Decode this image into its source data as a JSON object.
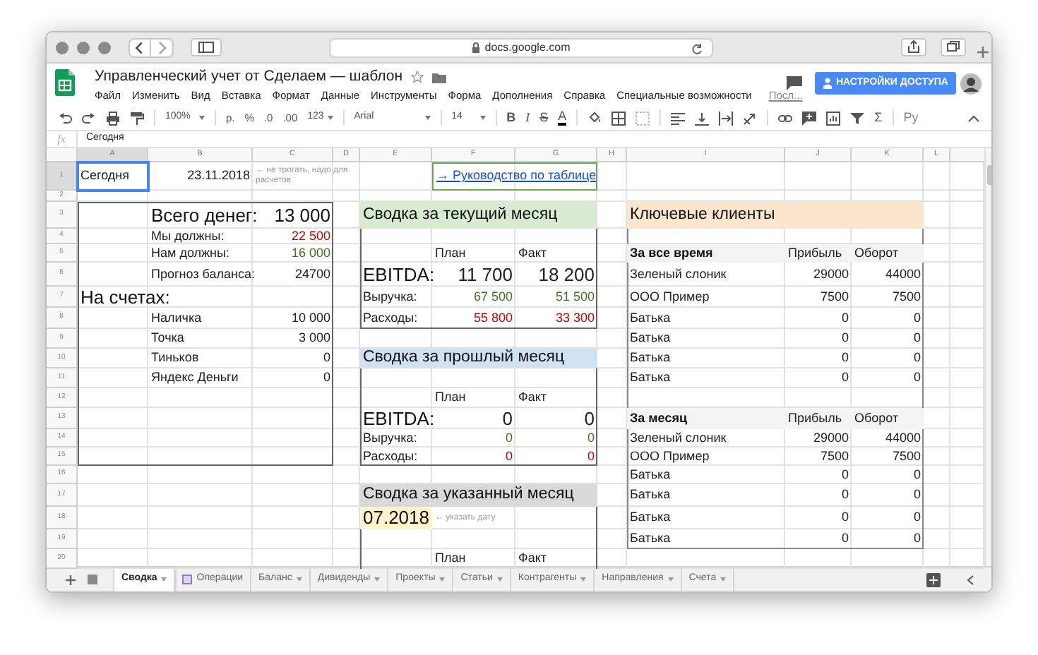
{
  "browser": {
    "url": "docs.google.com"
  },
  "document": {
    "title": "Управленческий учет от Сделаем — шаблон",
    "share_button": "НАСТРОЙКИ ДОСТУПА"
  },
  "menu": [
    "Файл",
    "Изменить",
    "Вид",
    "Вставка",
    "Формат",
    "Данные",
    "Инструменты",
    "Форма",
    "Дополнения",
    "Справка",
    "Специальные возможности",
    "Посл..."
  ],
  "toolbar": {
    "zoom": "100%",
    "currency": "р.",
    "percent": "%",
    "decimals_less": ".0",
    "decimals_more": ".00",
    "number_format": "123",
    "font": "Arial",
    "font_size": "14",
    "bold": "B",
    "italic": "I",
    "strikethrough": "S",
    "text_color": "A",
    "functions": "Σ",
    "input_tools": "Ру"
  },
  "formula_bar": {
    "label": "fx",
    "value": "Сегодня"
  },
  "column_headers": [
    "A",
    "B",
    "C",
    "D",
    "E",
    "F",
    "G",
    "H",
    "I",
    "J",
    "K",
    "L"
  ],
  "row_headers": [
    "1",
    "2",
    "3",
    "4",
    "5",
    "6",
    "7",
    "8",
    "9",
    "10",
    "11",
    "12",
    "13",
    "14",
    "15",
    "16",
    "17",
    "18",
    "19",
    "20"
  ],
  "today": {
    "label": "Сегодня",
    "selected": true,
    "value": "23.11.2018",
    "note": "← не трогать, надо для расчетов"
  },
  "guide_link": "→ Руководство по таблице",
  "balance": {
    "total_label": "Всего денег:",
    "total_value": "13 000",
    "items": [
      {
        "label": "Мы должны:",
        "value": "22 500",
        "kind": "negative"
      },
      {
        "label": "Нам должны:",
        "value": "16 000",
        "kind": "positive"
      },
      {
        "label": "Прогноз баланса:",
        "value": "24700",
        "kind": "neutral"
      }
    ],
    "accounts_title": "На счетах:",
    "accounts": [
      {
        "label": "Наличка",
        "value": "10 000"
      },
      {
        "label": "Точка",
        "value": "3 000"
      },
      {
        "label": "Тиньков",
        "value": "0"
      },
      {
        "label": "Яндекс Деньги",
        "value": "0"
      }
    ]
  },
  "summaries": [
    {
      "title": "Сводка за текущий месяц",
      "color": "#d9ead3",
      "columns": [
        "План",
        "Факт"
      ],
      "rows": [
        {
          "label": "EBITDA:",
          "kind": "total",
          "values": [
            "11 700",
            "18 200"
          ]
        },
        {
          "label": "Выручка:",
          "kind": "income",
          "values": [
            "67 500",
            "51 500"
          ]
        },
        {
          "label": "Расходы:",
          "kind": "expense",
          "values": [
            "55 800",
            "33 300"
          ]
        }
      ]
    },
    {
      "title": "Сводка за прошлый месяц",
      "color": "#cfe2f3",
      "columns": [
        "План",
        "Факт"
      ],
      "rows": [
        {
          "label": "EBITDA:",
          "kind": "total",
          "values": [
            "0",
            "0"
          ]
        },
        {
          "label": "Выручка:",
          "kind": "income",
          "values": [
            "0",
            "0"
          ]
        },
        {
          "label": "Расходы:",
          "kind": "expense",
          "values": [
            "0",
            "0"
          ]
        }
      ]
    },
    {
      "title": "Сводка за указанный месяц",
      "color": "#d9d9d9",
      "date": {
        "value": "07.2018",
        "note": "← указать дату"
      },
      "columns": [
        "План",
        "Факт"
      ]
    }
  ],
  "clients": {
    "title": "Ключевые клиенты",
    "color": "#fce5cd",
    "sections": [
      {
        "heading": "За все время",
        "columns": [
          "Прибыль",
          "Оборот"
        ],
        "rows": [
          {
            "name": "Зеленый слоник",
            "values": [
              "29000",
              "44000"
            ]
          },
          {
            "name": "ООО Пример",
            "values": [
              "7500",
              "7500"
            ]
          },
          {
            "name": "Батька",
            "values": [
              "0",
              "0"
            ]
          },
          {
            "name": "Батька",
            "values": [
              "0",
              "0"
            ]
          },
          {
            "name": "Батька",
            "values": [
              "0",
              "0"
            ]
          },
          {
            "name": "Батька",
            "values": [
              "0",
              "0"
            ]
          }
        ]
      },
      {
        "heading": "За месяц",
        "columns": [
          "Прибыль",
          "Оборот"
        ],
        "rows": [
          {
            "name": "Зеленый слоник",
            "values": [
              "29000",
              "44000"
            ]
          },
          {
            "name": "ООО Пример",
            "values": [
              "7500",
              "7500"
            ]
          },
          {
            "name": "Батька",
            "values": [
              "0",
              "0"
            ]
          },
          {
            "name": "Батька",
            "values": [
              "0",
              "0"
            ]
          },
          {
            "name": "Батька",
            "values": [
              "0",
              "0"
            ]
          },
          {
            "name": "Батька",
            "values": [
              "0",
              "0"
            ]
          }
        ]
      }
    ]
  },
  "sheet_tabs": [
    {
      "label": "Сводка",
      "selected": true
    },
    {
      "label": "Операции",
      "selected": false
    },
    {
      "label": "Баланс",
      "selected": false
    },
    {
      "label": "Дивиденды",
      "selected": false
    },
    {
      "label": "Проекты",
      "selected": false
    },
    {
      "label": "Статьи",
      "selected": false
    },
    {
      "label": "Контрагенты",
      "selected": false
    },
    {
      "label": "Направления",
      "selected": false
    },
    {
      "label": "Счета",
      "selected": false
    }
  ]
}
